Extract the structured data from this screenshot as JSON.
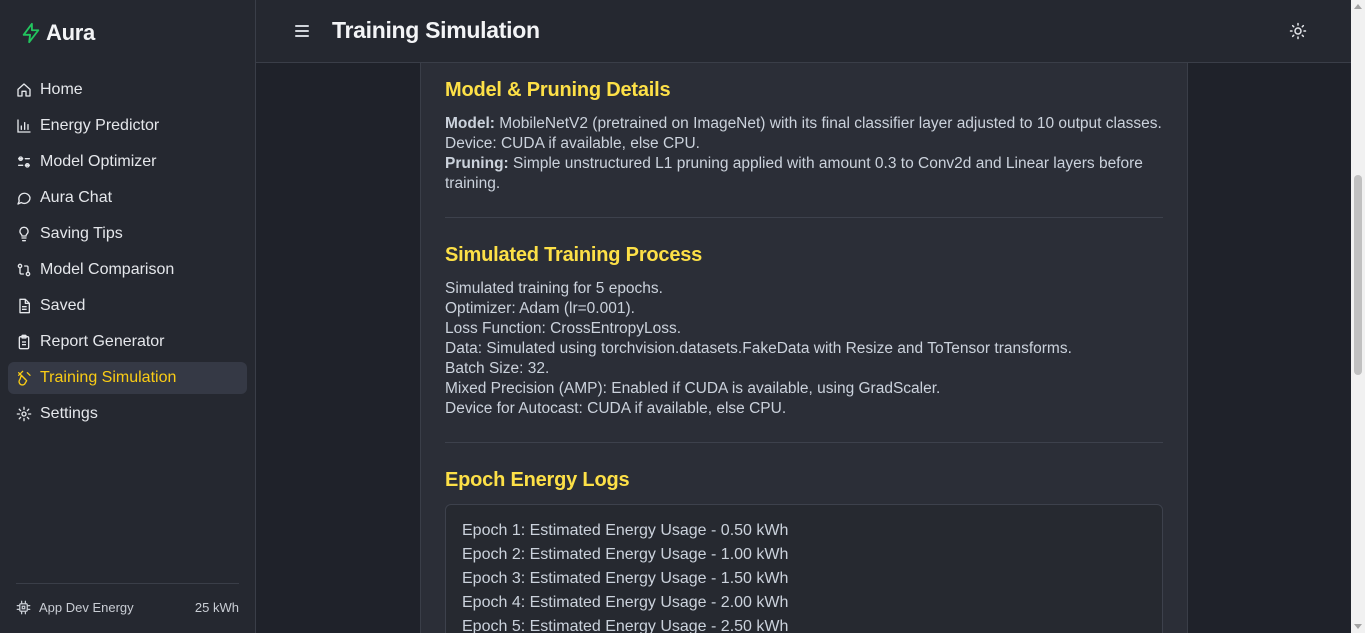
{
  "app": {
    "name": "Aura"
  },
  "nav": {
    "items": [
      {
        "label": "Home",
        "icon": "home-icon"
      },
      {
        "label": "Energy Predictor",
        "icon": "bar-chart-icon"
      },
      {
        "label": "Model Optimizer",
        "icon": "sliders-icon"
      },
      {
        "label": "Aura Chat",
        "icon": "chat-icon"
      },
      {
        "label": "Saving Tips",
        "icon": "lightbulb-icon"
      },
      {
        "label": "Model Comparison",
        "icon": "compare-icon"
      },
      {
        "label": "Saved",
        "icon": "document-icon"
      },
      {
        "label": "Report Generator",
        "icon": "clipboard-icon"
      },
      {
        "label": "Training Simulation",
        "icon": "flask-icon",
        "active": true
      },
      {
        "label": "Settings",
        "icon": "gear-icon"
      }
    ]
  },
  "footer": {
    "label": "App Dev Energy",
    "value": "25 kWh"
  },
  "header": {
    "title": "Training Simulation"
  },
  "sections": {
    "model": {
      "title": "Model & Pruning Details",
      "model_label": "Model:",
      "model_text": "MobileNetV2 (pretrained on ImageNet) with its final classifier layer adjusted to 10 output classes. Device: CUDA if available, else CPU.",
      "pruning_label": "Pruning:",
      "pruning_text": "Simple unstructured L1 pruning applied with amount 0.3 to Conv2d and Linear layers before training."
    },
    "training": {
      "title": "Simulated Training Process",
      "lines": [
        "Simulated training for 5 epochs.",
        "Optimizer: Adam (lr=0.001).",
        "Loss Function: CrossEntropyLoss.",
        "Data: Simulated using torchvision.datasets.FakeData with Resize and ToTensor transforms.",
        "Batch Size: 32.",
        "Mixed Precision (AMP): Enabled if CUDA is available, using GradScaler.",
        "Device for Autocast: CUDA if available, else CPU."
      ]
    },
    "logs": {
      "title": "Epoch Energy Logs",
      "lines": [
        "Epoch 1: Estimated Energy Usage - 0.50 kWh",
        "Epoch 2: Estimated Energy Usage - 1.00 kWh",
        "Epoch 3: Estimated Energy Usage - 1.50 kWh",
        "Epoch 4: Estimated Energy Usage - 2.00 kWh",
        "Epoch 5: Estimated Energy Usage - 2.50 kWh"
      ]
    }
  },
  "colors": {
    "accent": "#facc15",
    "heading": "#fde047",
    "brand_icon": "#22c55e",
    "background": "#1f222a",
    "sidebar": "#252830"
  }
}
